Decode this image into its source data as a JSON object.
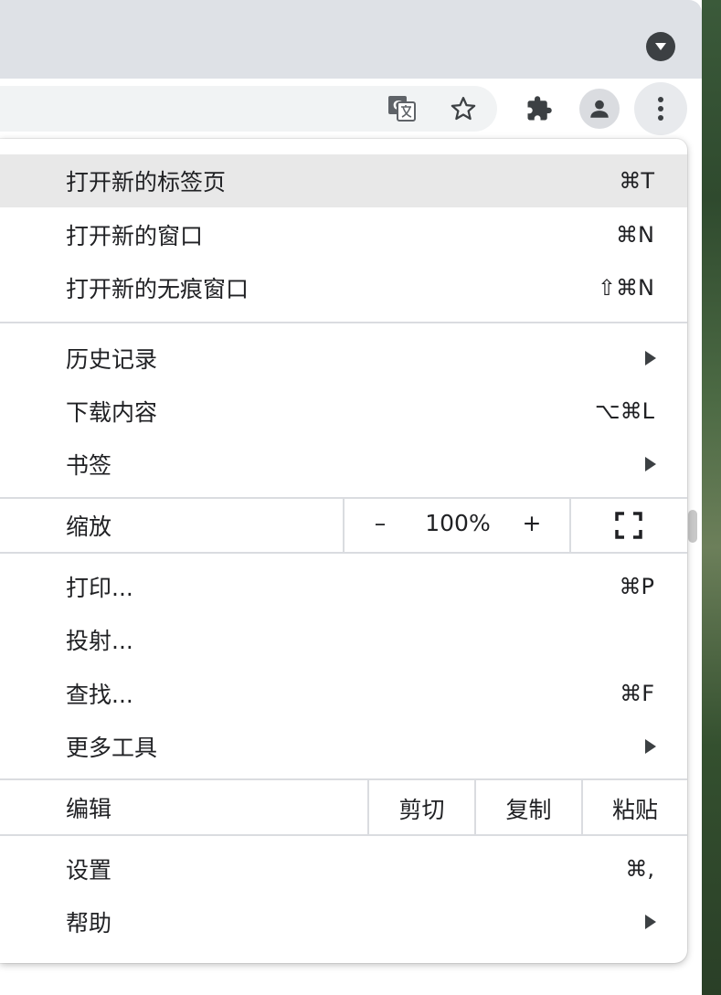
{
  "toolbar": {
    "icons": [
      "translate-icon",
      "bookmark-star-icon",
      "extensions-icon",
      "profile-icon",
      "menu-icon"
    ]
  },
  "menu": {
    "section1": [
      {
        "label": "打开新的标签页",
        "shortcut": "⌘T"
      },
      {
        "label": "打开新的窗口",
        "shortcut": "⌘N"
      },
      {
        "label": "打开新的无痕窗口",
        "shortcut": "⇧⌘N"
      }
    ],
    "section2": [
      {
        "label": "历史记录",
        "shortcut": ""
      },
      {
        "label": "下载内容",
        "shortcut": "⌥⌘L"
      },
      {
        "label": "书签",
        "shortcut": ""
      }
    ],
    "zoom": {
      "label": "缩放",
      "minus": "–",
      "level": "100%",
      "plus": "+"
    },
    "section3": [
      {
        "label": "打印...",
        "shortcut": "⌘P"
      },
      {
        "label": "投射...",
        "shortcut": ""
      },
      {
        "label": "查找...",
        "shortcut": "⌘F"
      },
      {
        "label": "更多工具",
        "shortcut": ""
      }
    ],
    "edit": {
      "label": "编辑",
      "cut": "剪切",
      "copy": "复制",
      "paste": "粘贴"
    },
    "section4": [
      {
        "label": "设置",
        "shortcut": "⌘,"
      },
      {
        "label": "帮助",
        "shortcut": ""
      }
    ]
  }
}
